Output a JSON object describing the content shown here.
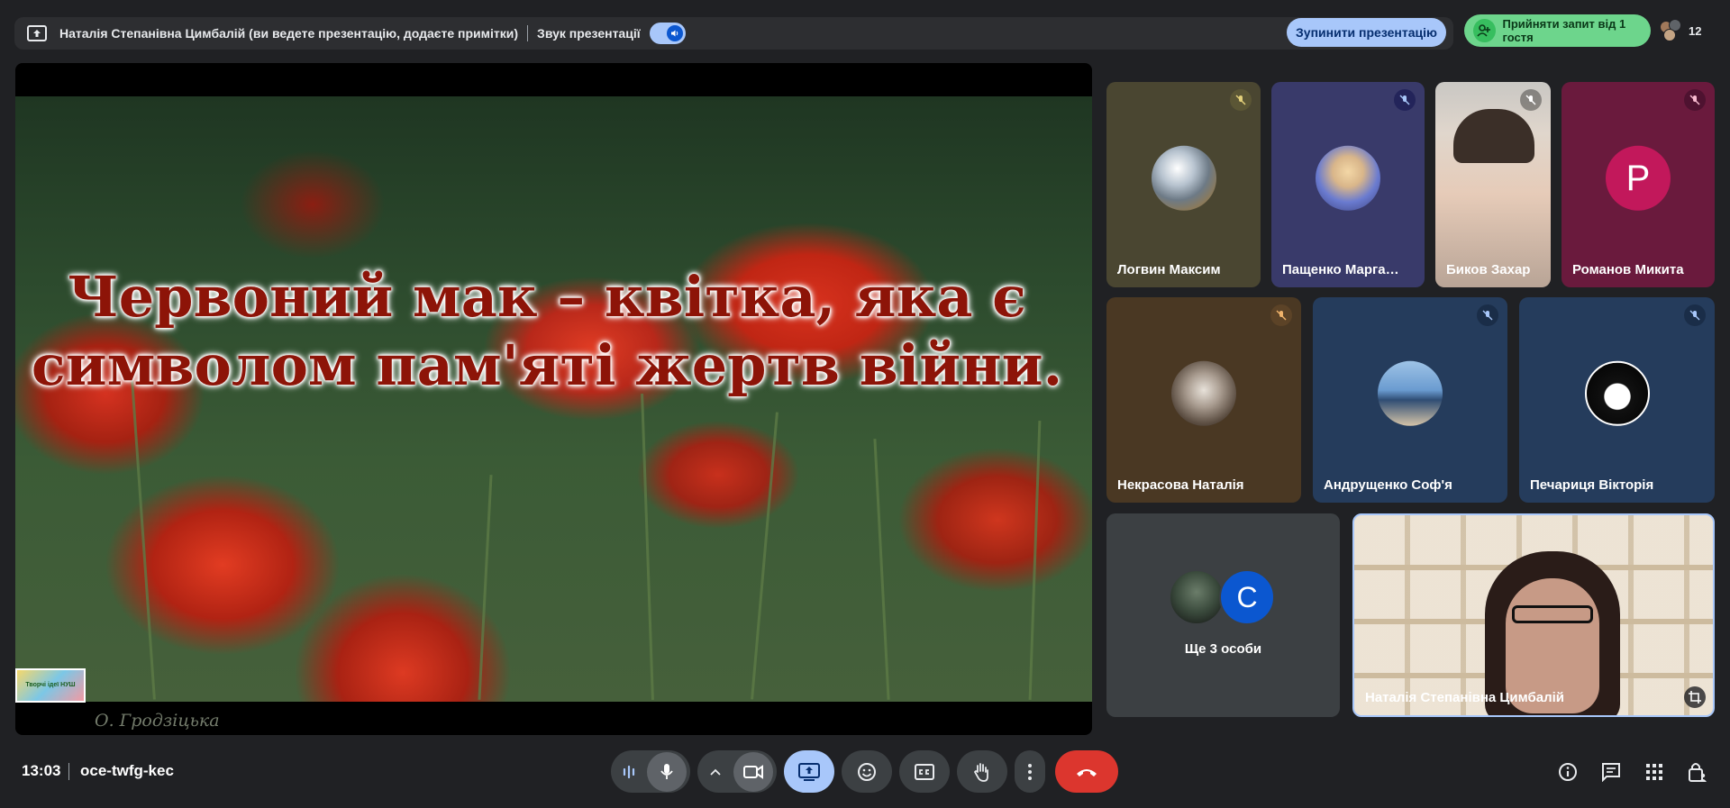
{
  "topbar": {
    "presenter_text": "Наталія Степанівна Цимбалій (ви ведете презентацію, додаєте примітки)",
    "sound_label": "Звук презентації",
    "stop_label": "Зупинити презентацію",
    "accept_label": "Прийняти запит від 1 гостя",
    "participant_count": "12"
  },
  "slide": {
    "title_line1": "Червоний мак – квітка, яка є",
    "title_line2": "символом пам'яті жертв війни.",
    "credit": "О. Гродзіцька",
    "logo_text": "Творчі ідеї НУШ"
  },
  "tiles": [
    {
      "name": "Логвин Максим",
      "muted": true,
      "bg": "#4a4631"
    },
    {
      "name": "Пащенко Марга…",
      "muted": true,
      "bg": "#393a6a"
    },
    {
      "name": "Биков Захар",
      "muted": true,
      "bg": "#8c8a86"
    },
    {
      "name": "Романов Микита",
      "muted": true,
      "bg": "#6a1a3d",
      "letter": "Р",
      "letter_bg": "#c2185b"
    },
    {
      "name": "Некрасова Наталія",
      "muted": true,
      "bg": "#4a3823"
    },
    {
      "name": "Андрущенко Соф'я",
      "muted": true,
      "bg": "#253c5c"
    },
    {
      "name": "Печариця Вікторія",
      "muted": true,
      "bg": "#253c5c"
    },
    {
      "name": "Наталія Степанівна Цимбалій",
      "muted": false,
      "bg": "#d9cbb6"
    }
  ],
  "others": {
    "label": "Ще 3 особи",
    "letter": "C",
    "letter_bg": "#0b57d0"
  },
  "bottombar": {
    "time": "13:03",
    "meeting_code": "oce-twfg-kec"
  }
}
